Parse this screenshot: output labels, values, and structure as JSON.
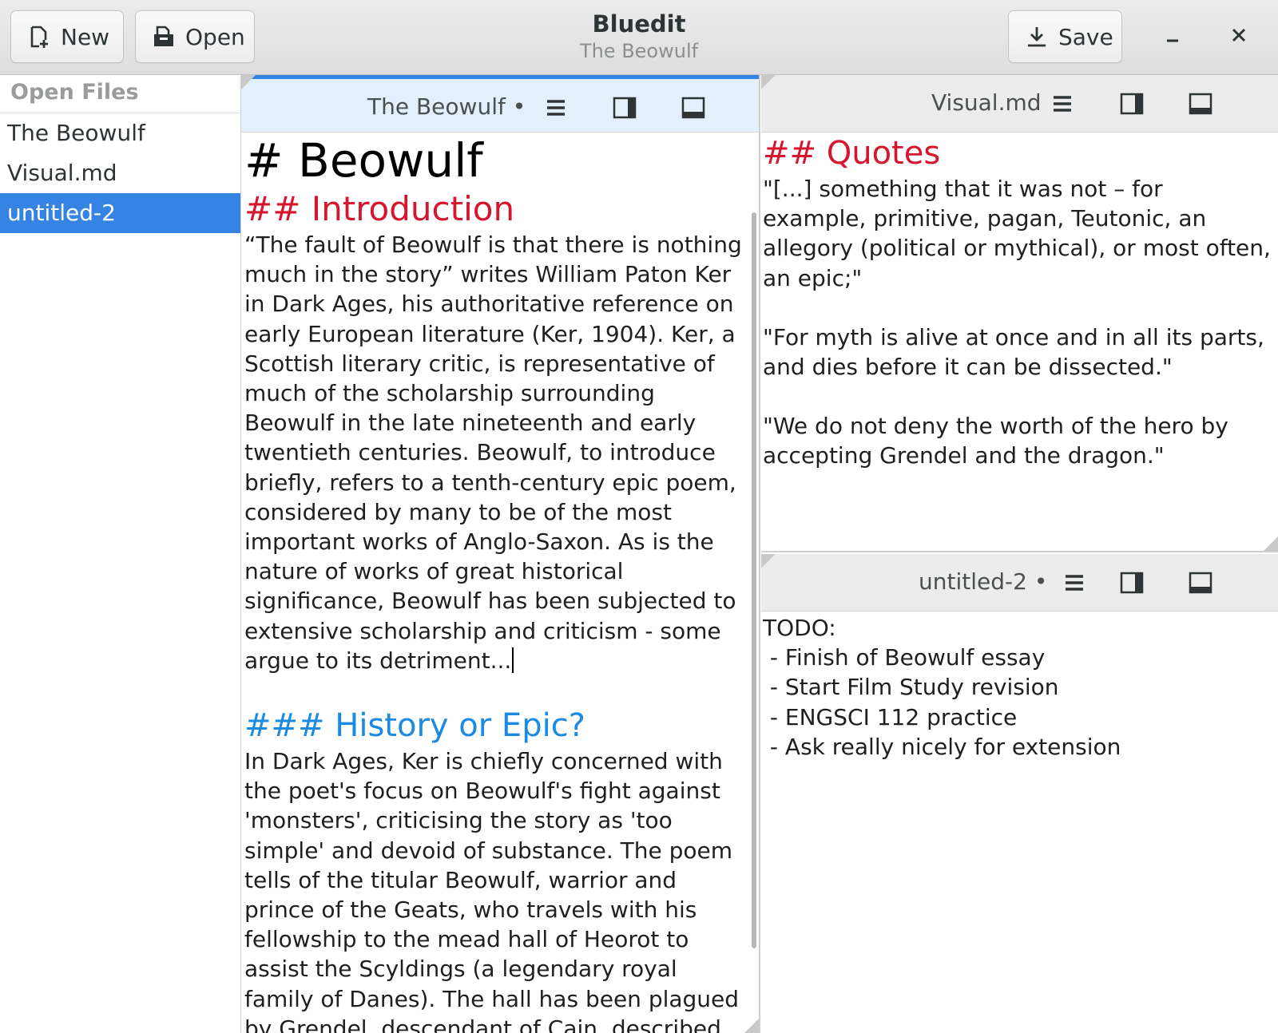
{
  "app": {
    "title": "Bluedit",
    "subtitle": "The Beowulf"
  },
  "toolbar": {
    "new_label": "New",
    "open_label": "Open",
    "save_label": "Save"
  },
  "sidebar": {
    "heading": "Open Files",
    "items": [
      {
        "label": "The Beowulf",
        "selected": false
      },
      {
        "label": "Visual.md",
        "selected": false
      },
      {
        "label": "untitled-2",
        "selected": true
      }
    ]
  },
  "panes": {
    "main": {
      "title": "The Beowulf •",
      "active": true,
      "h1": "# Beowulf",
      "h2": "## Introduction",
      "intro": "“The fault of Beowulf is that there is nothing much in the story” writes William Paton Ker in Dark Ages, his authoritative reference on early European literature (Ker, 1904). Ker, a Scottish literary critic, is representative of much of the scholarship surrounding Beowulf in the late nineteenth and early twentieth centuries. Beowulf, to introduce briefly, refers to a tenth-century epic poem, considered by many to be of the most important works of Anglo-Saxon. As is the nature of works of great historical significance, Beowulf has been subjected to extensive scholarship and criticism - some argue to its detriment...",
      "h3": "### History or Epic?",
      "history": "In Dark Ages, Ker is chiefly concerned with the poet's focus on Beowulf's fight against 'monsters', criticising the story as 'too simple' and devoid of substance. The poem tells of the titular Beowulf, warrior and prince of the Geats, who travels with his fellowship to the mead hall of Heorot to assist the Scyldings (a legendary royal family of Danes). The hall has been plagued by Grendel, descendant of Cain, described vaugely as a sort of inhuman monster, who"
    },
    "visual": {
      "title": "Visual.md",
      "h2": "## Quotes",
      "quote1": "\"[...] something that it was not – for example, primitive, pagan, Teutonic, an allegory (political or mythical), or most often, an epic;\"",
      "quote2": "\"For myth is alive at once and in all its parts, and dies before it can be dissected.\"",
      "quote3": "\"We do not deny the worth of the hero by accepting Grendel and the dragon.\""
    },
    "untitled": {
      "title": "untitled-2 •",
      "heading": "TODO:",
      "items": [
        " - Finish of Beowulf essay",
        " - Start Film Study revision",
        " - ENGSCI 112 practice",
        " - Ask really nicely for extension"
      ]
    }
  },
  "icons": {
    "new": "document-new-icon",
    "open": "document-open-icon",
    "save": "download-icon",
    "minimize": "minimize-icon",
    "close": "close-icon",
    "menu": "hamburger-menu-icon",
    "sidebar_toggle": "right-panel-icon",
    "bottom_toggle": "bottom-panel-icon"
  },
  "colors": {
    "accent": "#3584e4",
    "h2": "#d5162e",
    "h3": "#1a8ae3",
    "active_tab_bg": "#e3f0fc"
  }
}
